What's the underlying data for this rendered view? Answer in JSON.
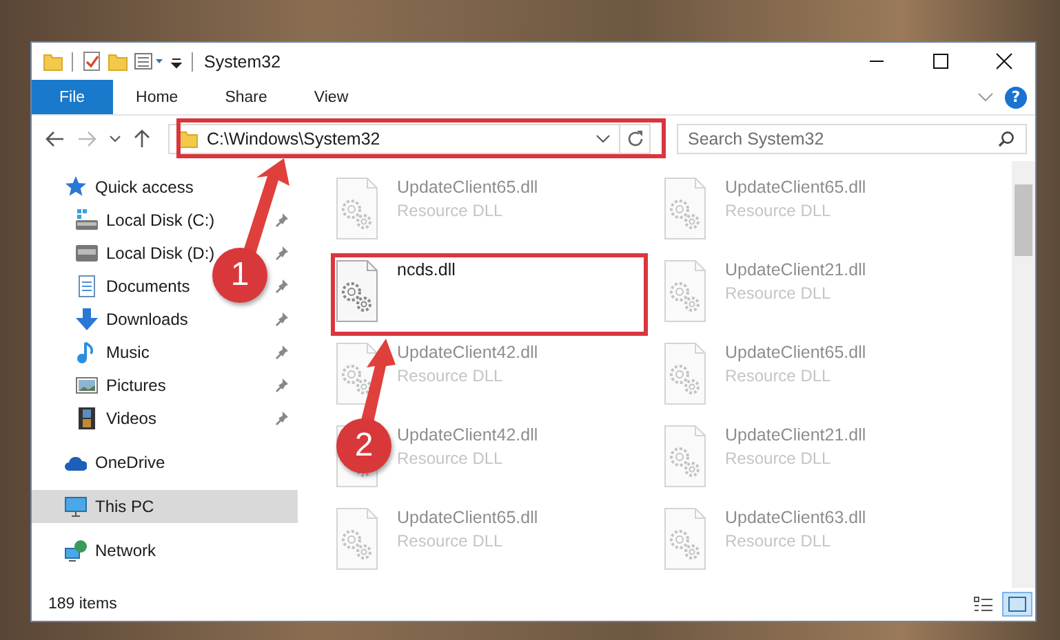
{
  "window": {
    "title": "System32"
  },
  "ribbon": {
    "tabs": [
      {
        "label": "File",
        "kind": "file",
        "selected": false
      },
      {
        "label": "Home",
        "kind": "tab",
        "selected": false
      },
      {
        "label": "Share",
        "kind": "tab",
        "selected": false
      },
      {
        "label": "View",
        "kind": "tab",
        "selected": false
      }
    ],
    "help": "?"
  },
  "address_bar": {
    "path": "C:\\Windows\\System32"
  },
  "search": {
    "placeholder": "Search System32"
  },
  "sidebar": {
    "items": [
      {
        "label": "Quick access",
        "selected": false,
        "children": [
          {
            "label": "Local Disk (C:)",
            "pinned": true,
            "selected": false
          },
          {
            "label": "Local Disk (D:)",
            "pinned": true,
            "selected": false
          },
          {
            "label": "Documents",
            "pinned": true,
            "selected": false
          },
          {
            "label": "Downloads",
            "pinned": true,
            "selected": false
          },
          {
            "label": "Music",
            "pinned": true,
            "selected": false
          },
          {
            "label": "Pictures",
            "pinned": true,
            "selected": false
          },
          {
            "label": "Videos",
            "pinned": true,
            "selected": false
          }
        ]
      },
      {
        "label": "OneDrive",
        "selected": false
      },
      {
        "label": "This PC",
        "selected": true
      },
      {
        "label": "Network",
        "selected": false
      }
    ]
  },
  "files": [
    {
      "name": "UpdateClient65.dll",
      "type": "Resource DLL",
      "blurred": true,
      "highlighted": false
    },
    {
      "name": "UpdateClient65.dll",
      "type": "Resource DLL",
      "blurred": true,
      "highlighted": false
    },
    {
      "name": "ncds.dll",
      "blurred": false,
      "highlighted": true
    },
    {
      "name": "UpdateClient21.dll",
      "type": "Resource DLL",
      "blurred": true,
      "highlighted": false
    },
    {
      "name": "UpdateClient42.dll",
      "type": "Resource DLL",
      "blurred": true,
      "highlighted": false
    },
    {
      "name": "UpdateClient65.dll",
      "type": "Resource DLL",
      "blurred": true,
      "highlighted": false
    },
    {
      "name": "UpdateClient42.dll",
      "type": "Resource DLL",
      "blurred": true,
      "highlighted": false
    },
    {
      "name": "UpdateClient21.dll",
      "type": "Resource DLL",
      "blurred": true,
      "highlighted": false
    },
    {
      "name": "UpdateClient65.dll",
      "type": "Resource DLL",
      "blurred": true,
      "highlighted": false
    },
    {
      "name": "UpdateClient63.dll",
      "type": "Resource DLL",
      "blurred": true,
      "highlighted": false
    }
  ],
  "status_bar": {
    "count": "189 items",
    "views": [
      {
        "kind": "details",
        "selected": false
      },
      {
        "kind": "large-icons",
        "selected": true
      }
    ]
  },
  "annotations": {
    "address_highlighted": true,
    "steps": [
      {
        "label": "1"
      },
      {
        "label": "2"
      }
    ]
  }
}
